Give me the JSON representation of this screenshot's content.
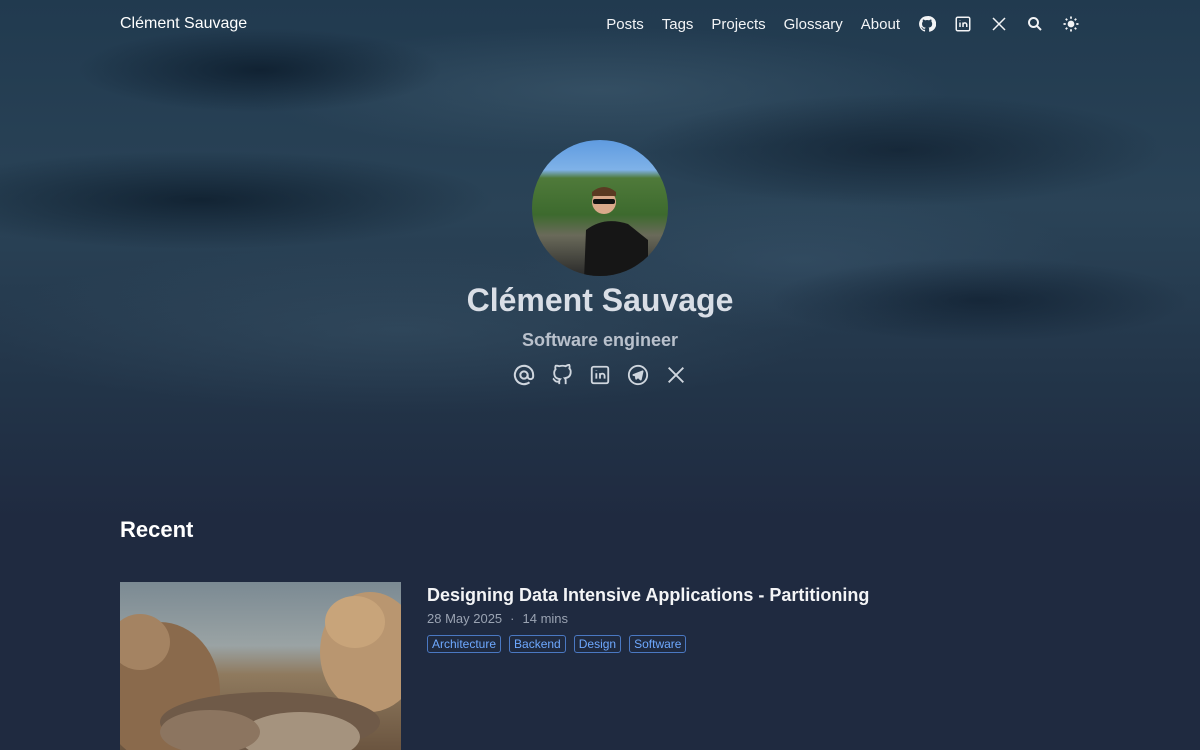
{
  "header": {
    "brand": "Clément Sauvage",
    "menu": [
      "Posts",
      "Tags",
      "Projects",
      "Glossary",
      "About"
    ],
    "icons": [
      "github-icon",
      "linkedin-icon",
      "x-icon",
      "search-icon",
      "theme-toggle-icon"
    ]
  },
  "profile": {
    "name": "Clément Sauvage",
    "subtitle": "Software engineer",
    "socials": [
      "email-icon",
      "github-icon",
      "linkedin-icon",
      "telegram-icon",
      "x-icon"
    ]
  },
  "recent": {
    "title": "Recent",
    "posts": [
      {
        "title": "Designing Data Intensive Applications - Partitioning",
        "date": "28 May 2025",
        "separator": "·",
        "read_time": "14 mins",
        "tags": [
          "Architecture",
          "Backend",
          "Design",
          "Software"
        ]
      }
    ]
  },
  "colors": {
    "background": "#1f2a40",
    "tag": "#6ea8fe"
  }
}
